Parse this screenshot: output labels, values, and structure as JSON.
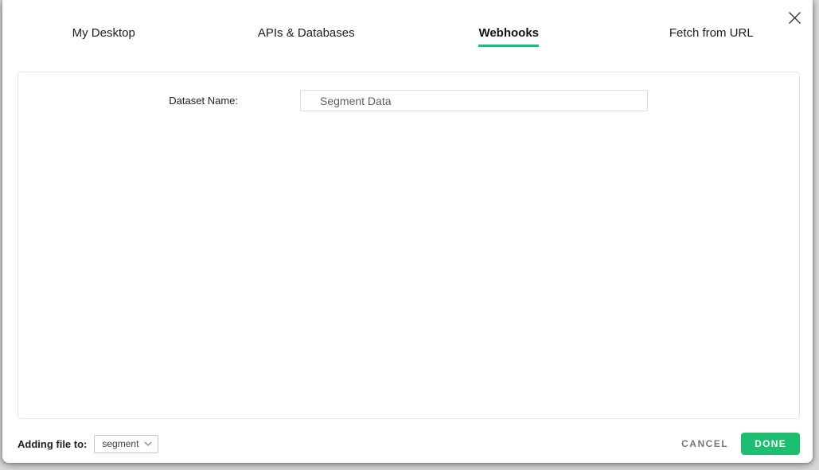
{
  "modal": {
    "tabs": [
      {
        "label": "My Desktop",
        "active": false
      },
      {
        "label": "APIs & Databases",
        "active": false
      },
      {
        "label": "Webhooks",
        "active": true
      },
      {
        "label": "Fetch from URL",
        "active": false
      }
    ],
    "form": {
      "dataset_name_label": "Dataset Name:",
      "dataset_name_value": "Segment Data"
    },
    "footer": {
      "adding_file_label": "Adding file to:",
      "folder_select_value": "segment",
      "cancel_label": "CANCEL",
      "done_label": "DONE"
    },
    "icons": {
      "close": "close-icon",
      "folder_chevron": "chevron-down-icon"
    },
    "colors": {
      "accent_green_button": "#1dbe70",
      "active_tab_underline": "#10c27e"
    }
  }
}
